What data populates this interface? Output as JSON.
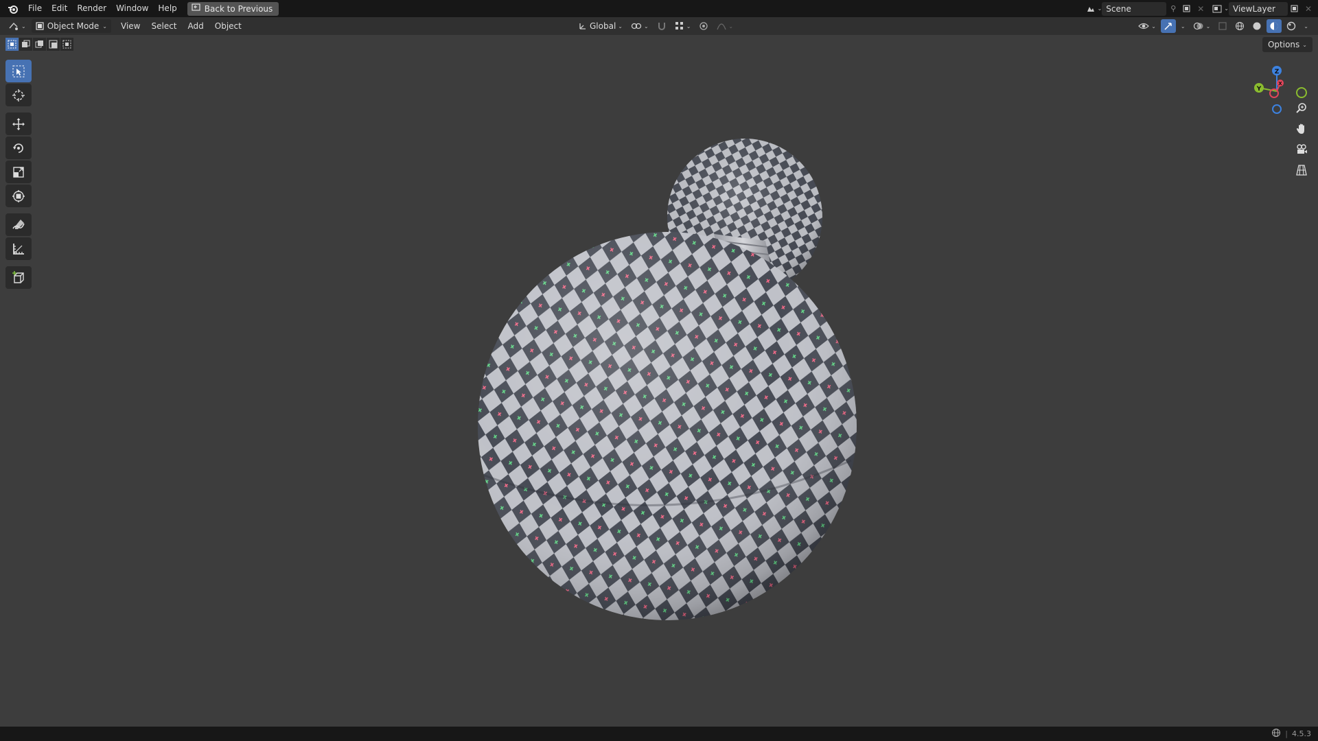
{
  "topbar": {
    "menus": [
      "File",
      "Edit",
      "Render",
      "Window",
      "Help"
    ],
    "back_label": "Back to Previous",
    "scene_label": "Scene",
    "viewlayer_label": "ViewLayer"
  },
  "header": {
    "mode_label": "Object Mode",
    "menus": [
      "View",
      "Select",
      "Add",
      "Object"
    ],
    "transform_orientation": "Global"
  },
  "viewport": {
    "options_label": "Options",
    "gizmo_axes": {
      "x": "X",
      "y": "Y",
      "z": "Z"
    }
  },
  "status": {
    "version": "4.5.3"
  },
  "colors": {
    "accent": "#4772b3",
    "x_axis": "#e2455a",
    "y_axis": "#8bbd2f",
    "z_axis": "#3d82e0"
  }
}
